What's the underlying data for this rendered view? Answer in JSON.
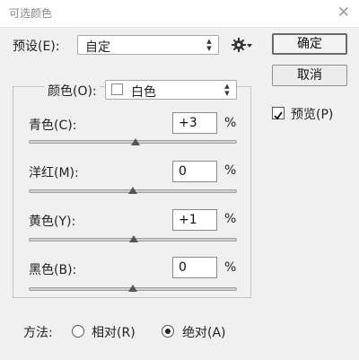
{
  "window": {
    "title": "可选颜色",
    "close_glyph": "✕"
  },
  "preset": {
    "label": "预设(E):",
    "value": "自定"
  },
  "gear_icon": "gear-icon",
  "buttons": {
    "ok": "确定",
    "cancel": "取消"
  },
  "preview": {
    "label": "预览(P)",
    "checked": true
  },
  "colors": {
    "label": "颜色(O):",
    "value": "白色"
  },
  "sliders": [
    {
      "label": "青色(C):",
      "value": "+3",
      "unit": "%",
      "level": 0.515
    },
    {
      "label": "洋红(M):",
      "value": "0",
      "unit": "%",
      "level": 0.5
    },
    {
      "label": "黄色(Y):",
      "value": "+1",
      "unit": "%",
      "level": 0.505
    },
    {
      "label": "黑色(B):",
      "value": "0",
      "unit": "%",
      "level": 0.5
    }
  ],
  "method": {
    "label": "方法:",
    "options": [
      {
        "label": "相对(R)",
        "selected": false
      },
      {
        "label": "绝对(A)",
        "selected": true
      }
    ]
  }
}
